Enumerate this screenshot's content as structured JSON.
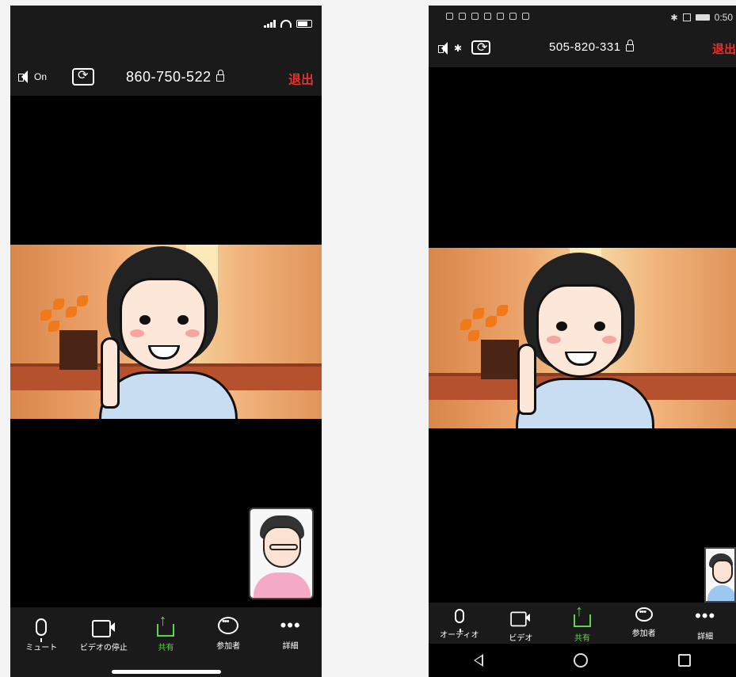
{
  "ios": {
    "status": {
      "signal": "signal-icon",
      "wifi": "wifi-icon",
      "battery": "battery-icon"
    },
    "top_bar": {
      "speaker_label": "On",
      "meeting_id": "860-750-522",
      "leave_label": "退出"
    },
    "toolbar": [
      {
        "name": "mute",
        "label": "ミュート"
      },
      {
        "name": "stop-video",
        "label": "ビデオの停止"
      },
      {
        "name": "share",
        "label": "共有"
      },
      {
        "name": "participants",
        "label": "参加者"
      },
      {
        "name": "more",
        "label": "詳細"
      }
    ]
  },
  "android": {
    "status": {
      "time": "0:50"
    },
    "top_bar": {
      "meeting_id": "505-820-331",
      "leave_label": "退出"
    },
    "toolbar": [
      {
        "name": "audio",
        "label": "オーディオ"
      },
      {
        "name": "video",
        "label": "ビデオ"
      },
      {
        "name": "share",
        "label": "共有"
      },
      {
        "name": "participants",
        "label": "参加者"
      },
      {
        "name": "more",
        "label": "詳細"
      }
    ]
  },
  "colors": {
    "leave": "#e8302c",
    "share": "#62d34c",
    "bar": "#1a1a1a"
  }
}
